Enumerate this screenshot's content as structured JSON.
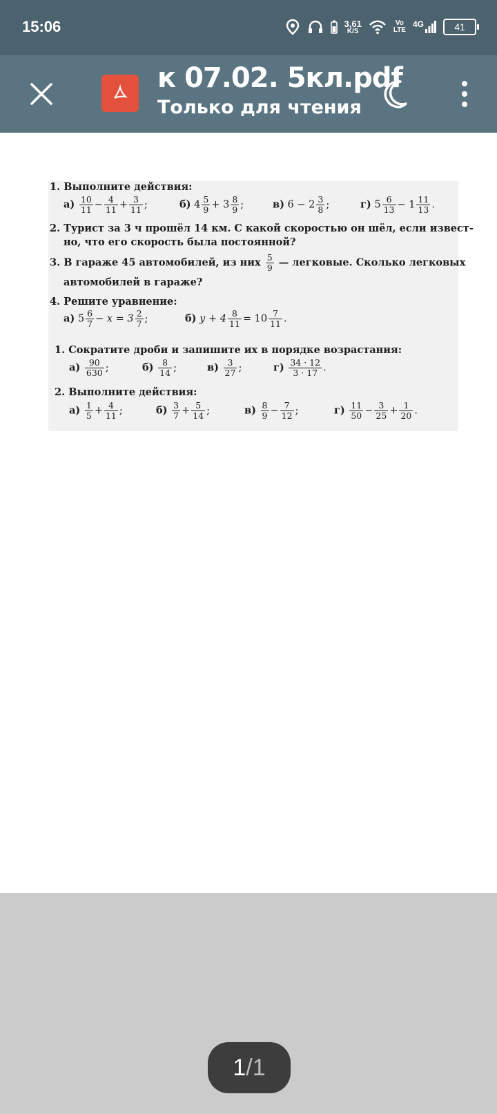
{
  "status_bar": {
    "time": "15:06",
    "net_speed_value": "3,61",
    "net_speed_unit": "K/S",
    "volte_top": "Vo",
    "volte_bottom": "LTE",
    "network": "4G",
    "battery": "41",
    "icons": [
      "location-icon",
      "headphones-icon",
      "battery-saver-icon",
      "wifi-icon",
      "signal-icon",
      "battery-icon"
    ]
  },
  "app_bar": {
    "title": "к 07.02. 5кл.pdf",
    "subtitle": "Только для чтения",
    "icons": [
      "close-icon",
      "pdf-file-icon",
      "night-mode-icon",
      "more-vertical-icon"
    ],
    "accent_color": "#5a7481",
    "pdf_icon_color": "#e3513c"
  },
  "document": {
    "section1": {
      "task1": {
        "num": "1.",
        "text": "Выполните действия:",
        "a": {
          "label": "а)",
          "f1n": "10",
          "f1d": "11",
          "op1": "−",
          "f2n": "4",
          "f2d": "11",
          "op2": "+",
          "f3n": "3",
          "f3d": "11",
          "end": ";"
        },
        "b": {
          "label": "б)",
          "w1": "4",
          "f1n": "5",
          "f1d": "9",
          "op": "+ 3",
          "f2n": "8",
          "f2d": "9",
          "end": ";"
        },
        "c": {
          "label": "в)",
          "expr": "6 − 2",
          "fn": "3",
          "fd": "8",
          "end": ";"
        },
        "d": {
          "label": "г)",
          "w1": "5",
          "f1n": "6",
          "f1d": "13",
          "op": "− 1",
          "f2n": "11",
          "f2d": "13",
          "end": "."
        }
      },
      "task2": {
        "num": "2.",
        "line1": "Турист за 3 ч прошёл 14 км. С какой скоростью он шёл, если извест-",
        "line2": "но, что его скорость была постоянной?"
      },
      "task3": {
        "num": "3.",
        "line1a": "В гараже 45 автомобилей, из них",
        "fn": "5",
        "fd": "9",
        "line1b": "— легковые. Сколько легковых",
        "line2": "автомобилей в гараже?"
      },
      "task4": {
        "num": "4.",
        "text": "Решите уравнение:",
        "a": {
          "label": "а)",
          "w1": "5",
          "f1n": "6",
          "f1d": "7",
          "mid": "− x = 3",
          "f2n": "2",
          "f2d": "7",
          "end": ";"
        },
        "b": {
          "label": "б)",
          "pre": "y + 4",
          "f1n": "8",
          "f1d": "11",
          "mid": "= 10",
          "f2n": "7",
          "f2d": "11",
          "end": "."
        }
      }
    },
    "section2": {
      "task1": {
        "num": "1.",
        "text": "Сократите дроби и запишите их в порядке возрастания:",
        "a": {
          "label": "а)",
          "n": "90",
          "d": "630",
          "end": ";"
        },
        "b": {
          "label": "б)",
          "n": "8",
          "d": "14",
          "end": ";"
        },
        "c": {
          "label": "в)",
          "n": "3",
          "d": "27",
          "end": ";"
        },
        "d": {
          "label": "г)",
          "n": "34 · 12",
          "d": "3 · 17",
          "end": "."
        }
      },
      "task2": {
        "num": "2.",
        "text": "Выполните действия:",
        "a": {
          "label": "а)",
          "f1n": "1",
          "f1d": "5",
          "op": "+",
          "f2n": "4",
          "f2d": "11",
          "end": ";"
        },
        "b": {
          "label": "б)",
          "f1n": "3",
          "f1d": "7",
          "op": "+",
          "f2n": "5",
          "f2d": "14",
          "end": ";"
        },
        "c": {
          "label": "в)",
          "f1n": "8",
          "f1d": "9",
          "op": "−",
          "f2n": "7",
          "f2d": "12",
          "end": ";"
        },
        "d": {
          "label": "г)",
          "f1n": "11",
          "f1d": "50",
          "op1": "−",
          "f2n": "3",
          "f2d": "25",
          "op2": "+",
          "f3n": "1",
          "f3d": "20",
          "end": "."
        }
      }
    }
  },
  "pager": {
    "current": "1",
    "separator": "/",
    "total": "1"
  }
}
